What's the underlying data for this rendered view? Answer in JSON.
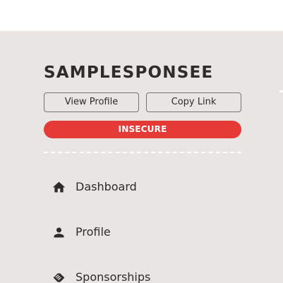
{
  "profile": {
    "username": "SAMPLESPONSEE",
    "view_profile_label": "View Profile",
    "copy_link_label": "Copy Link",
    "status_badge": "INSECURE"
  },
  "nav": {
    "items": [
      {
        "label": "Dashboard",
        "icon": "home-icon"
      },
      {
        "label": "Profile",
        "icon": "person-icon"
      },
      {
        "label": "Sponsorships",
        "icon": "handshake-icon"
      }
    ]
  },
  "colors": {
    "background": "#e8e5e2",
    "topbar": "#ffffff",
    "text": "#2e2b2a",
    "badge": "#e63a37",
    "button_border": "#77726f"
  }
}
